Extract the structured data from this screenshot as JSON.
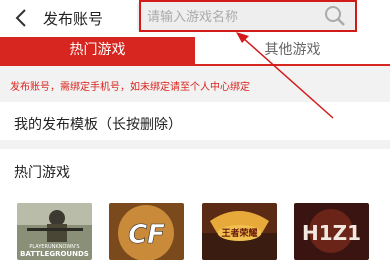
{
  "header": {
    "title": "发布账号",
    "search_placeholder": "请输入游戏名称",
    "back_icon": "chevron-left-icon",
    "search_icon": "search-icon"
  },
  "tabs": [
    {
      "label": "热门游戏",
      "active": true
    },
    {
      "label": "其他游戏",
      "active": false
    }
  ],
  "notice": "发布账号，需绑定手机号，如未绑定请至个人中心绑定",
  "templates": {
    "label": "我的发布模板（长按删除）"
  },
  "hot_games": {
    "label": "热门游戏",
    "items": [
      {
        "name": "PLAYERUNKNOWN'S BATTLEGROUNDS",
        "line1": "PLAYERUNKNOWN'S",
        "line2": "BATTLEGROUNDS"
      },
      {
        "name": "CF"
      },
      {
        "name": "王者荣耀"
      },
      {
        "name": "H1Z1"
      }
    ]
  },
  "colors": {
    "accent": "#d7251f",
    "annotation": "#d31a1a",
    "notice_bg": "#f2f2f2"
  }
}
